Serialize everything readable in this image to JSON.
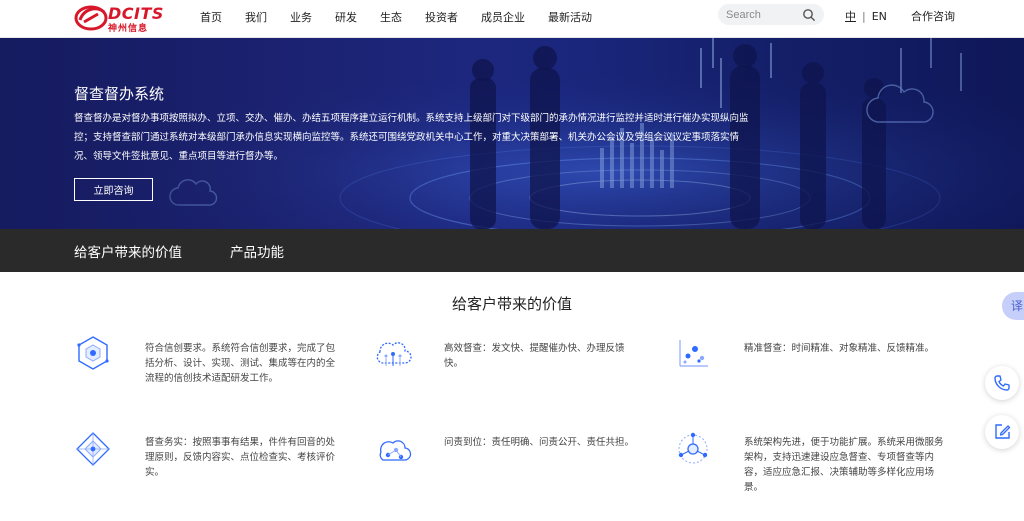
{
  "header": {
    "logo_text": "DCITS",
    "logo_sub": "神州信息",
    "nav": [
      "首页",
      "我们",
      "业务",
      "研发",
      "生态",
      "投资者",
      "成员企业",
      "最新活动"
    ],
    "search_placeholder": "Search",
    "lang_zh": "中",
    "lang_sep": "|",
    "lang_en": "EN",
    "contact": "合作咨询"
  },
  "banner": {
    "title": "督查督办系统",
    "description": "督查督办是对督办事项按照拟办、立项、交办、催办、办结五项程序建立运行机制。系统支持上级部门对下级部门的承办情况进行监控并适时进行催办实现纵向监控；支持督查部门通过系统对本级部门承办信息实现横向监控等。系统还可围绕党政机关中心工作，对重大决策部署、机关办公会议及党组会议议定事项落实情况、领导文件签批意见、重点项目等进行督办等。",
    "button": "立即咨询"
  },
  "tabs": [
    "给客户带来的价值",
    "产品功能"
  ],
  "section": {
    "title": "给客户带来的价值",
    "features": [
      {
        "icon": "cube-icon",
        "text": "符合信创要求。系统符合信创要求，完成了包括分析、设计、实现、测试、集成等在内的全流程的信创技术适配研发工作。"
      },
      {
        "icon": "cloud-network-icon",
        "text": "高效督查：发文快、提醒催办快、办理反馈快。"
      },
      {
        "icon": "scatter-chart-icon",
        "text": "精准督查：时间精准、对象精准、反馈精准。"
      },
      {
        "icon": "network-diamond-icon",
        "text": "督查务实：按照事事有结果，件件有回音的处理原则，反馈内容实、点位检查实、考核评价实。"
      },
      {
        "icon": "cloud-nodes-icon",
        "text": "问责到位：责任明确、问责公开、责任共担。"
      },
      {
        "icon": "hub-icon",
        "text": "系统架构先进，便于功能扩展。系统采用微服务架构，支持迅速建设应急督查、专项督查等内容，适应应急汇报、决策辅助等多样化应用场景。"
      }
    ]
  },
  "floating": {
    "tab_label": "译"
  },
  "colors": {
    "brand_red": "#d7182a",
    "banner_blue": "#1c2a86",
    "tabbar_dark": "#2a2a2a",
    "accent_blue": "#2f6bff"
  }
}
